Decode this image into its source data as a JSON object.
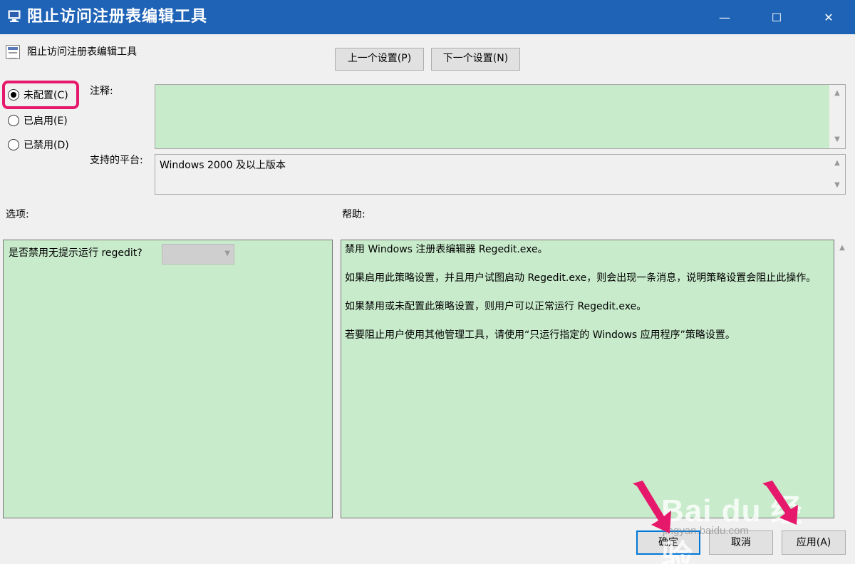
{
  "window": {
    "title": "阻止访问注册表编辑工具",
    "controls": {
      "minimize": "—",
      "maximize": "☐",
      "close": "✕"
    }
  },
  "header": {
    "policy_name": "阻止访问注册表编辑工具",
    "prev_button": "上一个设置(P)",
    "next_button": "下一个设置(N)"
  },
  "state_options": [
    {
      "label": "未配置(C)",
      "checked": true
    },
    {
      "label": "已启用(E)",
      "checked": false
    },
    {
      "label": "已禁用(D)",
      "checked": false
    }
  ],
  "labels": {
    "note": "注释:",
    "platform": "支持的平台:",
    "options": "选项:",
    "help": "帮助:"
  },
  "note_value": "",
  "platform_value": "Windows 2000 及以上版本",
  "options": {
    "question": "是否禁用无提示运行 regedit?",
    "selected": ""
  },
  "help": {
    "paragraphs": [
      "禁用 Windows 注册表编辑器 Regedit.exe。",
      "如果启用此策略设置，并且用户试图启动 Regedit.exe，则会出现一条消息，说明策略设置会阻止此操作。",
      "如果禁用或未配置此策略设置，则用户可以正常运行 Regedit.exe。",
      "若要阻止用户使用其他管理工具，请使用“只运行指定的 Windows 应用程序”策略设置。"
    ]
  },
  "footer": {
    "ok": "确定",
    "cancel": "取消",
    "apply": "应用(A)"
  },
  "watermark": {
    "brand": "Bai du 经验",
    "url": "jingyan.baidu.com"
  },
  "colors": {
    "titlebar": "#1f63b6",
    "field_green": "#c8ebcb",
    "highlight": "#e6186b"
  }
}
